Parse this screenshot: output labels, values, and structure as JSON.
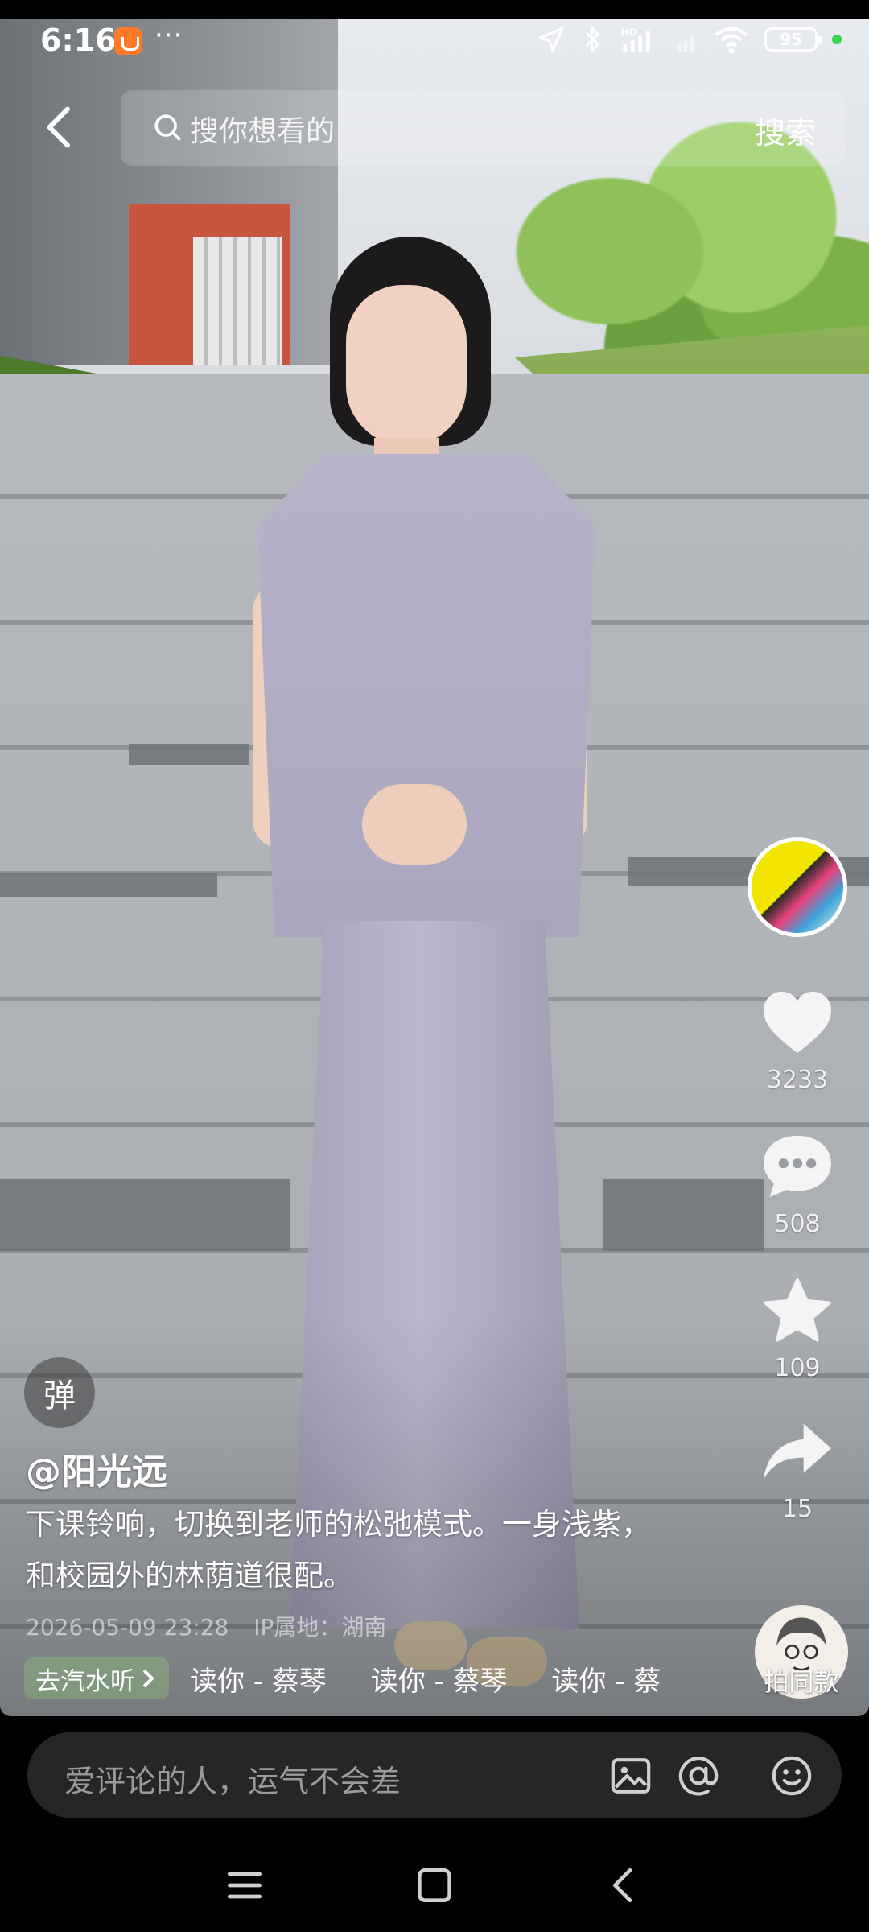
{
  "status_bar": {
    "time": "6:16",
    "more": "···",
    "battery": "95"
  },
  "search": {
    "placeholder": "搜你想看的",
    "button_label": "搜索"
  },
  "actions": {
    "like_count": "3233",
    "comment_count": "508",
    "favorite_count": "109",
    "share_count": "15"
  },
  "post": {
    "danmu_label": "弹",
    "author": "@阳光远",
    "description": "下课铃响，切换到老师的松弛模式。一身浅紫，和校园外的林荫道很配。",
    "date": "2026-05-09 23:28",
    "ip_location": "IP属地：湖南",
    "music_tag": "去汽水听",
    "music_tracks": [
      "读你 - 蔡琴",
      "读你 - 蔡琴",
      "读你 - 蔡"
    ],
    "same_style_label": "拍同款"
  },
  "comment_bar": {
    "placeholder": "爱评论的人，运气不会差"
  },
  "colors": {
    "background": "#000000",
    "comment_bar": "#262626",
    "accent_orange": "#ff7a28",
    "status_green": "#39d353"
  }
}
